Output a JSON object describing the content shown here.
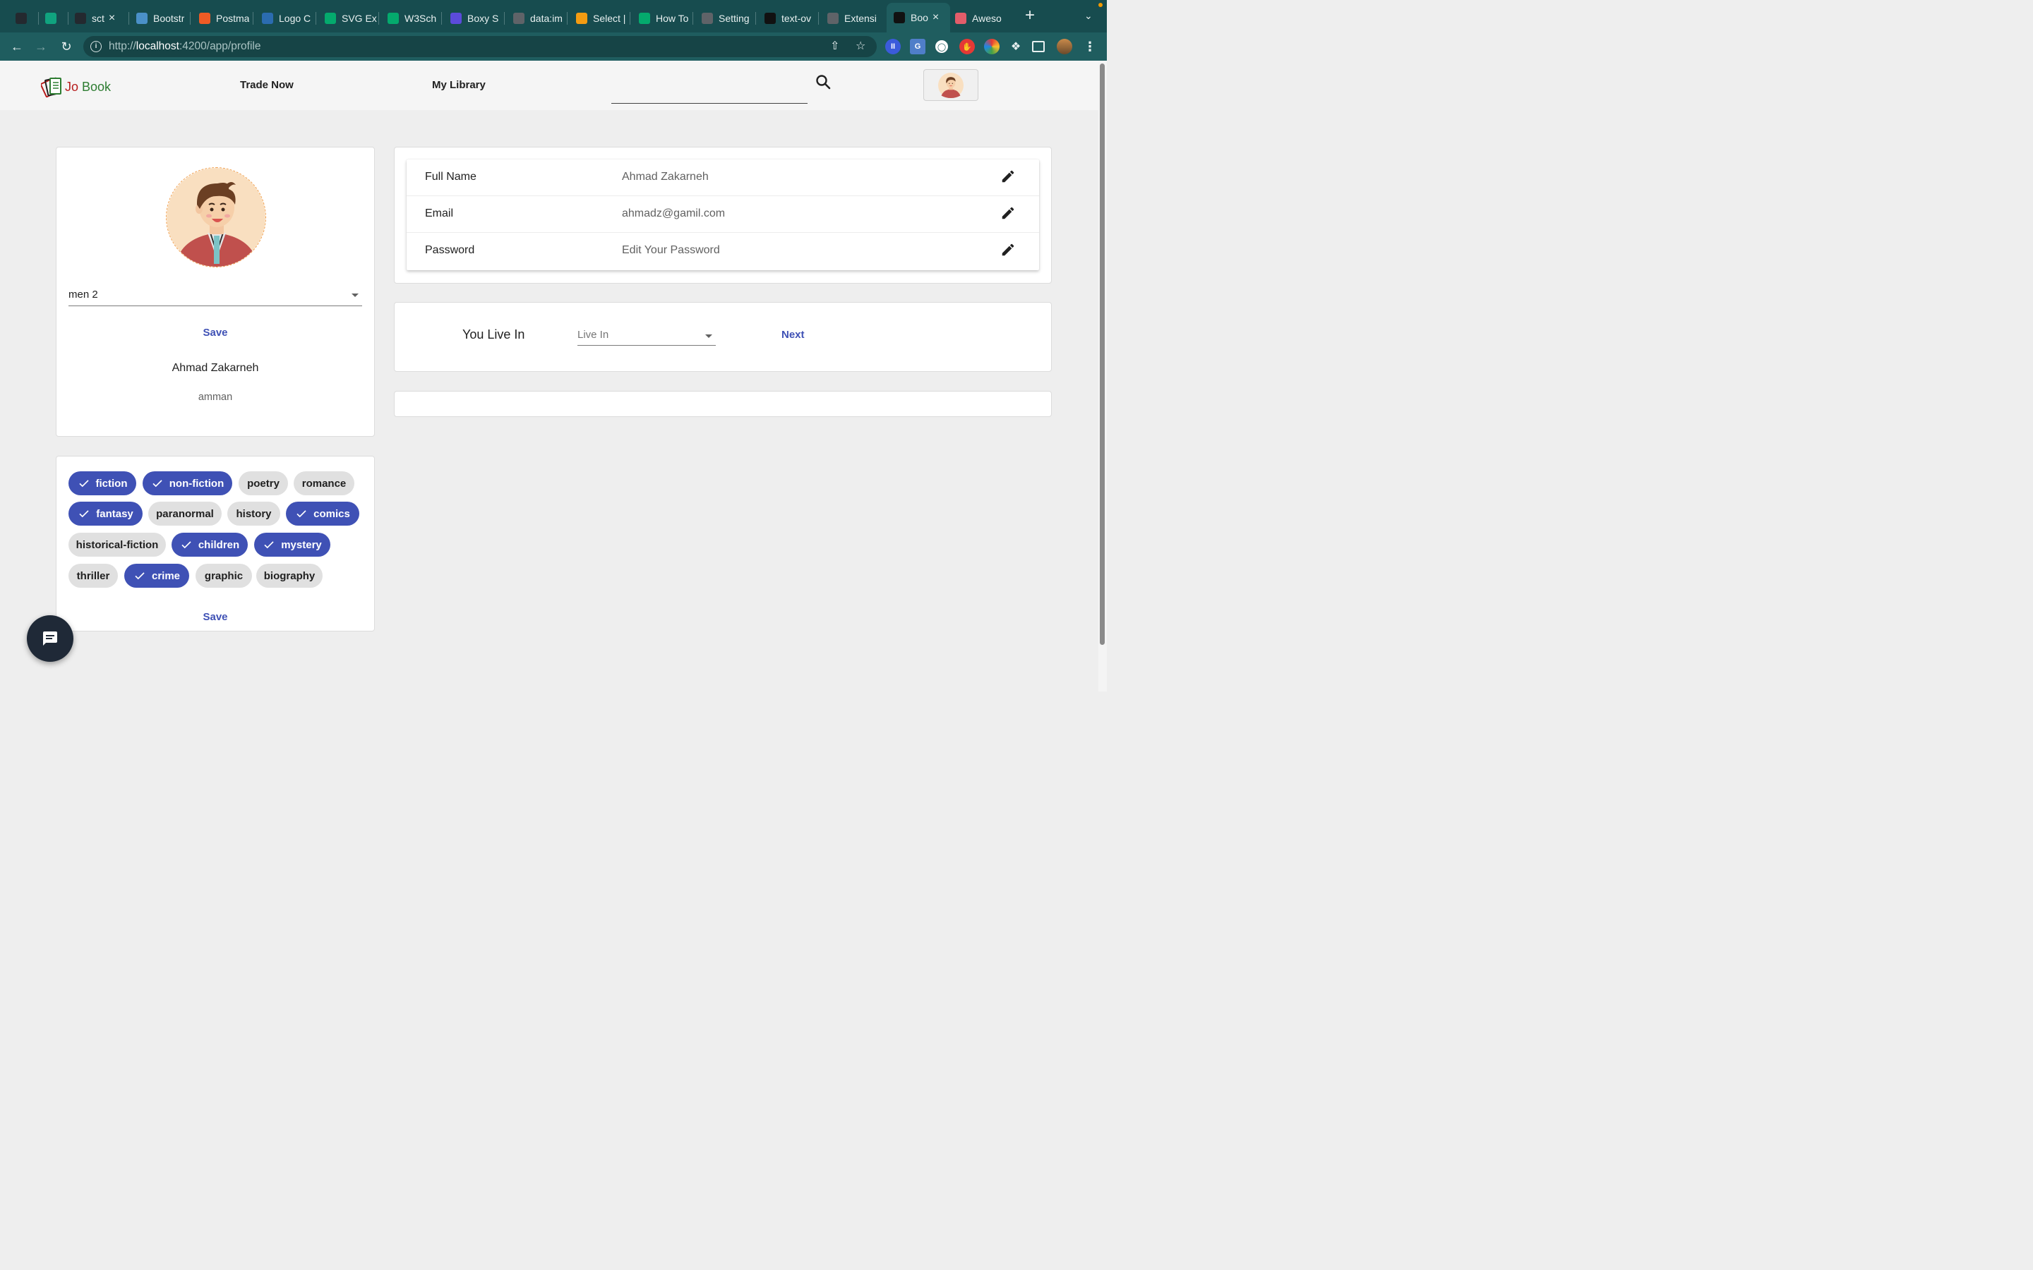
{
  "browser": {
    "tabs": [
      {
        "title": "",
        "favicon": "github-icon",
        "color": "#24292f"
      },
      {
        "title": "",
        "favicon": "chatgpt-icon",
        "color": "#10a37f"
      },
      {
        "title": "sct",
        "favicon": "github-icon",
        "color": "#24292f"
      },
      {
        "title": "Bootstr",
        "favicon": "bootstrap-icon",
        "color": "#4a90c8"
      },
      {
        "title": "Postma",
        "favicon": "postman-icon",
        "color": "#ef5b25"
      },
      {
        "title": "Logo C",
        "favicon": "logo-icon",
        "color": "#2b6cb0"
      },
      {
        "title": "SVG Ex",
        "favicon": "w3schools-icon",
        "color": "#04aa6d"
      },
      {
        "title": "W3Sch",
        "favicon": "w3schools-icon",
        "color": "#04aa6d"
      },
      {
        "title": "Boxy S",
        "favicon": "boxy-icon",
        "color": "#5b4bdb"
      },
      {
        "title": "data:im",
        "favicon": "globe-icon",
        "color": "#5f6368"
      },
      {
        "title": "Select |",
        "favicon": "shield-icon",
        "color": "#f39c12"
      },
      {
        "title": "How To",
        "favicon": "w3schools-icon",
        "color": "#04aa6d"
      },
      {
        "title": "Setting",
        "favicon": "gear-icon",
        "color": "#5f6368"
      },
      {
        "title": "text-ov",
        "favicon": "mdn-icon",
        "color": "#111111"
      },
      {
        "title": "Extensi",
        "favicon": "puzzle-icon",
        "color": "#5f6368"
      },
      {
        "title": "Boo",
        "favicon": "angular-icon",
        "color": "#111111"
      },
      {
        "title": "Aweso",
        "favicon": "awesome-icon",
        "color": "#e35d6a"
      }
    ],
    "url_scheme": "http://",
    "url_host": "localhost",
    "url_rest": ":4200/app/profile",
    "accent": "#174c4f"
  },
  "header": {
    "brand_jo": "Jo",
    "brand_book": "Book",
    "nav": [
      "Trade Now",
      "My Library"
    ],
    "search_placeholder": ""
  },
  "profile": {
    "avatar_option": "men 2",
    "save_label": "Save",
    "name": "Ahmad Zakarneh",
    "city": "amman"
  },
  "genres": {
    "chips": [
      {
        "label": "fiction",
        "selected": true
      },
      {
        "label": "non-fiction",
        "selected": true
      },
      {
        "label": "poetry",
        "selected": false
      },
      {
        "label": "romance",
        "selected": false
      },
      {
        "label": "fantasy",
        "selected": true
      },
      {
        "label": "paranormal",
        "selected": false
      },
      {
        "label": "history",
        "selected": false
      },
      {
        "label": "comics",
        "selected": true
      },
      {
        "label": "historical-fiction",
        "selected": false
      },
      {
        "label": "children",
        "selected": true
      },
      {
        "label": "mystery",
        "selected": true
      },
      {
        "label": "thriller",
        "selected": false
      },
      {
        "label": "crime",
        "selected": true
      },
      {
        "label": "graphic",
        "selected": false
      },
      {
        "label": "biography",
        "selected": false
      }
    ],
    "save_label": "Save"
  },
  "account": {
    "rows": [
      {
        "label": "Full Name",
        "value": "Ahmad Zakarneh"
      },
      {
        "label": "Email",
        "value": "ahmadz@gamil.com"
      },
      {
        "label": "Password",
        "value": "Edit Your Password"
      }
    ]
  },
  "location": {
    "label": "You Live In",
    "placeholder": "Live In",
    "next_label": "Next"
  },
  "colors": {
    "primary": "#3f51b5",
    "chip_bg": "#e0e0e0",
    "fab": "#1f2937"
  }
}
